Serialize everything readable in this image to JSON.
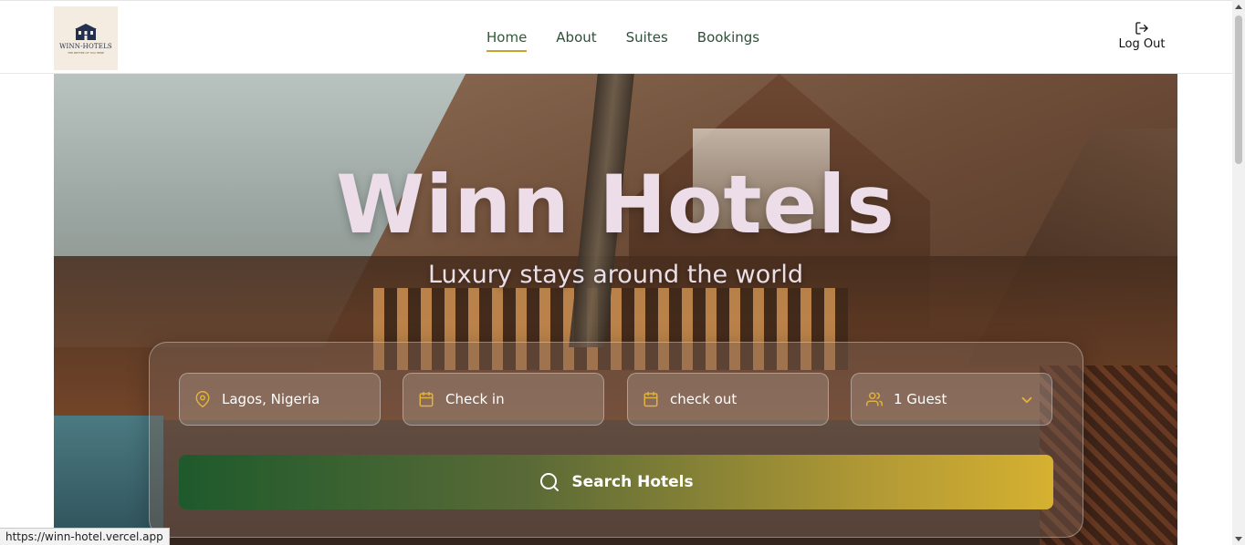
{
  "header": {
    "logo": {
      "name": "WINN-HOTELS",
      "tagline": "THE BETTER OF YOU HERE"
    },
    "nav": [
      {
        "label": "Home",
        "active": true
      },
      {
        "label": "About",
        "active": false
      },
      {
        "label": "Suites",
        "active": false
      },
      {
        "label": "Bookings",
        "active": false
      }
    ],
    "logout_label": "Log Out"
  },
  "hero": {
    "title": "Winn Hotels",
    "subtitle": "Luxury stays around the world"
  },
  "search": {
    "location": "Lagos, Nigeria",
    "check_in": "Check in",
    "check_out": "check out",
    "guests": "1 Guest",
    "button_label": "Search Hotels"
  },
  "status_bar": {
    "url": "https://winn-hotel.vercel.app"
  },
  "colors": {
    "accent_gold": "#c9a227",
    "nav_green": "#2f4f3a",
    "button_start": "#1e5a2c",
    "button_end": "#d6b131"
  },
  "icons": [
    "map-pin-icon",
    "calendar-icon",
    "users-icon",
    "chevron-down-icon",
    "search-icon",
    "log-out-icon"
  ]
}
